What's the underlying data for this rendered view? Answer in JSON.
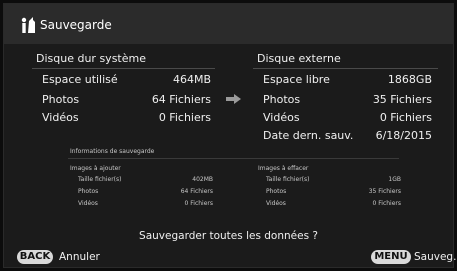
{
  "header": {
    "title": "Sauvegarde",
    "icon": "person-with-camera-icon"
  },
  "system_disk": {
    "heading": "Disque dur système",
    "rows": [
      {
        "label": "Espace utilisé",
        "value": "464MB"
      },
      {
        "label": "Photos",
        "value": "64 Fichiers"
      },
      {
        "label": "Vidéos",
        "value": "0 Fichiers"
      }
    ]
  },
  "external_disk": {
    "heading": "Disque externe",
    "rows": [
      {
        "label": "Espace libre",
        "value": "1868GB"
      },
      {
        "label": "Photos",
        "value": "35 Fichiers"
      },
      {
        "label": "Vidéos",
        "value": "0 Fichiers"
      },
      {
        "label": "Date dern. sauv.",
        "value": "6/18/2015"
      }
    ]
  },
  "backup_info": {
    "heading": "Informations de sauvegarde",
    "add": {
      "title": "Images à ajouter",
      "rows": [
        {
          "label": "Taille fichier(s)",
          "value": "402MB"
        },
        {
          "label": "Photos",
          "value": "64 Fichiers"
        },
        {
          "label": "Vidéos",
          "value": "0 Fichiers"
        }
      ]
    },
    "erase": {
      "title": "Images à effacer",
      "rows": [
        {
          "label": "Taille fichier(s)",
          "value": "1GB"
        },
        {
          "label": "Photos",
          "value": "35 Fichiers"
        },
        {
          "label": "Vidéos",
          "value": "0 Fichiers"
        }
      ]
    }
  },
  "prompt": "Sauvegarder toutes les données ?",
  "footer": {
    "back_key": "BACK",
    "back_label": "Annuler",
    "menu_key": "MENU",
    "menu_label": "Sauveg."
  }
}
